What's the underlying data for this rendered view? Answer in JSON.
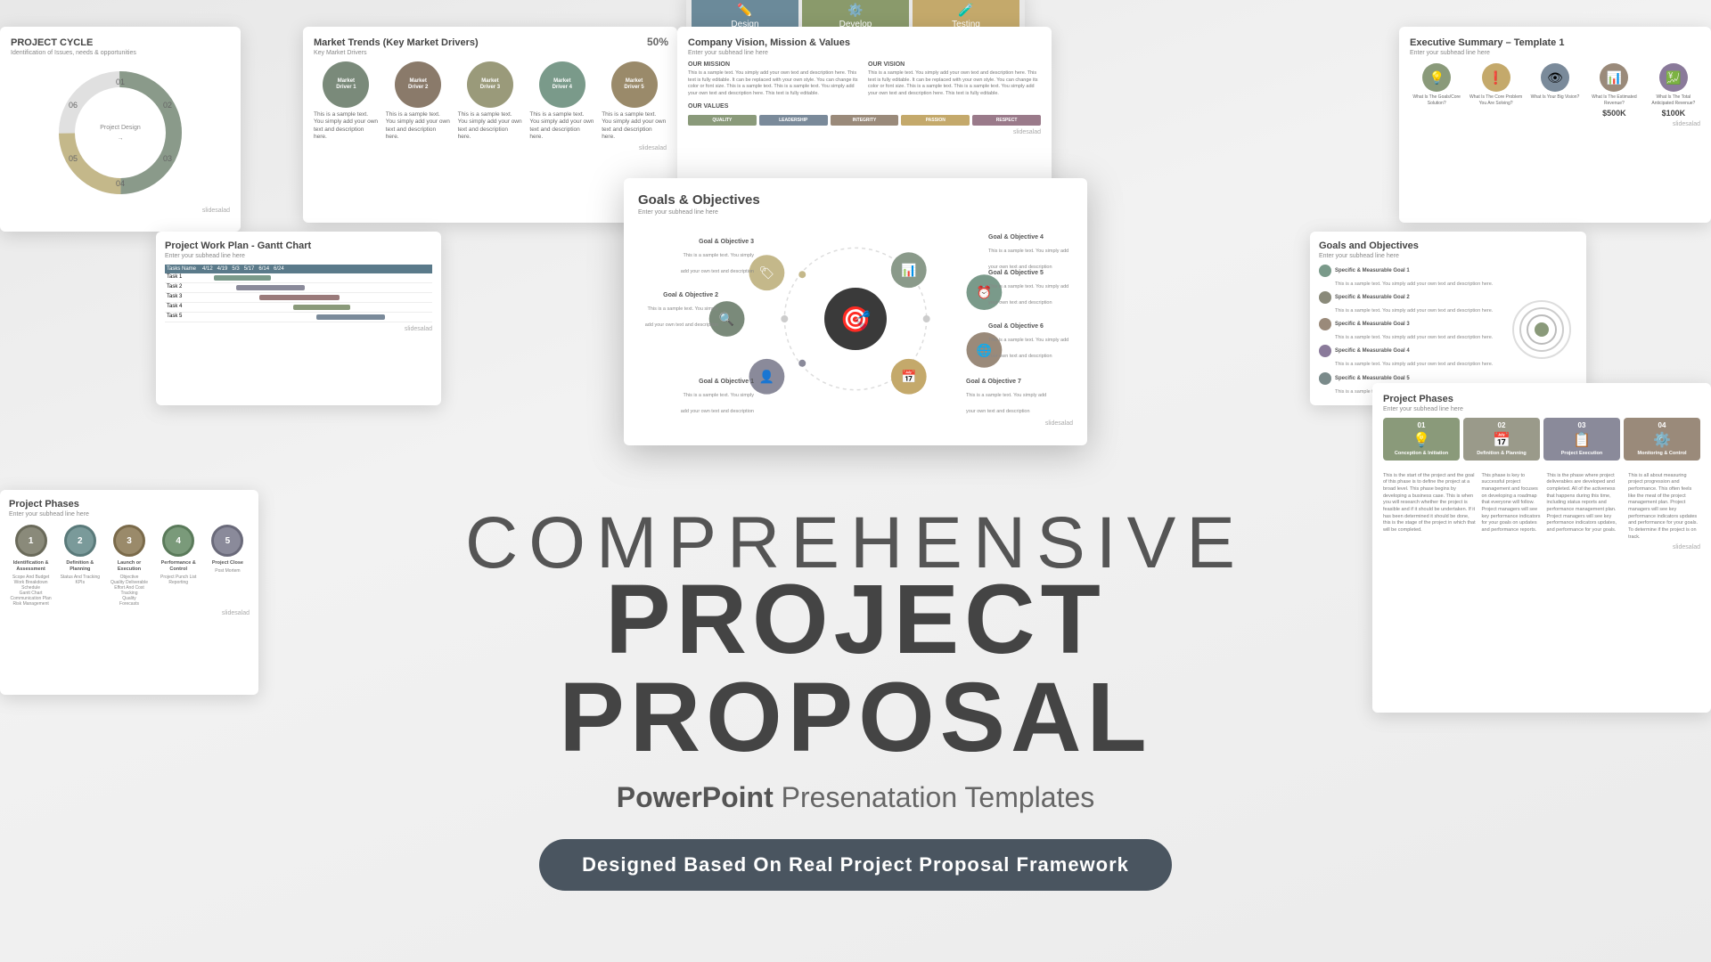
{
  "page": {
    "title": "Comprehensive Project Proposal",
    "subtitle_line1": "COMPREHENSIVE",
    "subtitle_line2": "PROJECT PROPOSAL",
    "subtitle_desc": "PowerPoint Presenatation Templates",
    "subtitle_desc_bold": "PowerPoint",
    "badge_text": "Designed Based On Real Project Proposal Framework",
    "bg_color": "#f0f0f0"
  },
  "tabs_slide": {
    "tabs": [
      {
        "label": "Design",
        "icon": "✏️",
        "active": true,
        "color": "#6b8a9a"
      },
      {
        "label": "Develop",
        "icon": "⚙️",
        "active": true,
        "color": "#8a9a6b"
      },
      {
        "label": "Testing",
        "icon": "🧪",
        "active": true,
        "color": "#c4a96b"
      }
    ]
  },
  "project_cycle_slide": {
    "title": "PROJECT CYCLE",
    "subtitle": "Identification of Issues, needs & opportunities",
    "labels": [
      "01",
      "02",
      "03",
      "04",
      "05",
      "06"
    ],
    "brand": "slidesalad"
  },
  "market_trends_slide": {
    "title": "Market Trends (Key Market Drivers)",
    "subtitle": "Key Market Drivers",
    "percentage": "50%",
    "drivers": [
      {
        "label": "Market Driver 1",
        "color": "#7a8a7a"
      },
      {
        "label": "Market Driver 2",
        "color": "#8a7a6a"
      },
      {
        "label": "Market Driver 3",
        "color": "#9a9a7a"
      },
      {
        "label": "Market Driver 4",
        "color": "#7a9a8a"
      },
      {
        "label": "Market Driver 5",
        "color": "#9a8a6a"
      }
    ],
    "driver_desc": "This is a sample text. You simply add your own text and description here.",
    "brand": "slidesalad"
  },
  "company_vision_slide": {
    "title": "Company Vision, Mission & Values",
    "subtitle": "Enter your subhead line here",
    "mission_title": "OUR MISSION",
    "mission_text": "This is a sample text. You simply add your own text and description here. This text is fully editable. It can be replaced with your own style. You can change its color or font size. This is a sample text. This is a sample text. You simply add your own text and description here. This text is fully editable.",
    "vision_title": "OUR VISION",
    "vision_text": "This is a sample text. You simply add your own text and description here. This text is fully editable. It can be replaced with your own style. You can change its color or font size. This is a sample text. This is a sample text. You simply add your own text and description here. This text is fully editable.",
    "values_title": "OUR VALUES",
    "values": [
      "QUALITY",
      "LEADERSHIP",
      "INTEGRITY",
      "PASSION",
      "RESPECT"
    ],
    "brand": "slidesalad"
  },
  "exec_summary_slide": {
    "title": "Executive Summary – Template 1",
    "subtitle": "Enter your subhead line here",
    "icons": [
      {
        "label": "What Is The Goals/Core Solution?",
        "icon": "💡",
        "color": "#8a9a7a"
      },
      {
        "label": "What Is The Core Problem You Are Solving?",
        "icon": "❗",
        "color": "#c4a96b"
      },
      {
        "label": "What Is Your Big Vision?",
        "icon": "👁",
        "color": "#7a8a9a"
      },
      {
        "label": "What Is The Estimated Revenue?",
        "icon": "📊",
        "color": "#9a8a7a"
      },
      {
        "label": "What Is The Total Anticipated Revenue?",
        "icon": "💹",
        "color": "#8a7a9a"
      }
    ],
    "revenue1": "$500K",
    "revenue2": "$100K",
    "brand": "slidesalad"
  },
  "goals_slide": {
    "title": "Goals & Objectives",
    "subtitle": "Enter your subhead line here",
    "center_icon": "🎯",
    "goals": [
      {
        "label": "Goal & Objective 1",
        "desc": "This is a sample text. You simply add your own text and description",
        "icon": "👤",
        "position": "bottom-left"
      },
      {
        "label": "Goal & Objective 2",
        "desc": "This is a sample text. You simply add your own text and description",
        "icon": "🔍",
        "position": "left"
      },
      {
        "label": "Goal & Objective 3",
        "desc": "This is a sample text. You simply add your own text and description",
        "icon": "🏷️",
        "position": "top-left"
      },
      {
        "label": "Goal & Objective 4",
        "desc": "This is a sample text. You simply add your own text and description",
        "icon": "📊",
        "position": "top-right"
      },
      {
        "label": "Goal & Objective 5",
        "desc": "This is a sample text. You simply add your own text and description",
        "icon": "⏰",
        "position": "right"
      },
      {
        "label": "Goal & Objective 6",
        "desc": "This is a sample text. You simply add your own text and description",
        "icon": "🌐",
        "position": "right-lower"
      },
      {
        "label": "Goal & Objective 7",
        "desc": "This is a sample text. You simply add your own text and description",
        "icon": "📅",
        "position": "bottom-right"
      }
    ],
    "brand": "slidesalad"
  },
  "work_plan_slide": {
    "title": "Project Work Plan - Gantt Chart",
    "subtitle": "Enter your subhead line here",
    "tasks": [
      {
        "name": "Task 1",
        "start": "5%",
        "width": "25%",
        "color": "#7a9a8a"
      },
      {
        "name": "Task 2",
        "start": "15%",
        "width": "30%",
        "color": "#8a8a9a"
      },
      {
        "name": "Task 3",
        "start": "25%",
        "width": "35%",
        "color": "#9a7a7a"
      },
      {
        "name": "Task 4",
        "start": "40%",
        "width": "25%",
        "color": "#8a9a7a"
      },
      {
        "name": "Task 5",
        "start": "50%",
        "width": "30%",
        "color": "#7a8a9a"
      }
    ],
    "brand": "slidesalad"
  },
  "goals2_slide": {
    "title": "Goals and Objectives",
    "subtitle": "Enter your subhead line here",
    "items": [
      {
        "label": "Specific & Measurable Goal 1",
        "desc": "This is a sample text. You simply add your own text and description here.",
        "color": "#7a9a8a"
      },
      {
        "label": "Specific & Measurable Goal 2",
        "desc": "This is a sample text. You simply add your own text and description here.",
        "color": "#8a8a7a"
      },
      {
        "label": "Specific & Measurable Goal 3",
        "desc": "This is a sample text. You simply add your own text and description here.",
        "color": "#9a8a7a"
      },
      {
        "label": "Specific & Measurable Goal 4",
        "desc": "This is a sample text. You simply add your own text and description here.",
        "color": "#8a7a9a"
      },
      {
        "label": "Specific & Measurable Goal 5",
        "desc": "This is a sample text. You simply add your own text and description here.",
        "color": "#7a8a8a"
      }
    ],
    "brand": "slidesalad"
  },
  "phases_left_slide": {
    "title": "Project Phases",
    "subtitle": "Enter your subhead line here",
    "phases": [
      {
        "num": "1",
        "label": "Identification & Assessment",
        "color": "#9a9a8a",
        "border": "#7a7a6a"
      },
      {
        "num": "2",
        "label": "Definition & Planning",
        "color": "#8a9a9a",
        "border": "#6a7a7a"
      },
      {
        "num": "3",
        "label": "Launch or Execution",
        "color": "#9a8a7a",
        "border": "#7a6a5a"
      },
      {
        "num": "4",
        "label": "Performance & Control",
        "color": "#8a9a8a",
        "border": "#6a7a6a"
      },
      {
        "num": "5",
        "label": "Project Close",
        "color": "#8a8a9a",
        "border": "#6a6a7a"
      }
    ],
    "brand": "slidesalad"
  },
  "phases_right_slide": {
    "title": "Project Phases",
    "subtitle": "Enter your subhead line here",
    "phases": [
      {
        "num": "01",
        "label": "Conception & Initiation",
        "icon": "💡",
        "color": "#8a9a7a"
      },
      {
        "num": "02",
        "label": "Definition & Planning",
        "icon": "📅",
        "color": "#9a9a8a"
      },
      {
        "num": "03",
        "label": "Project Execution",
        "icon": "📋",
        "color": "#8a8a9a"
      },
      {
        "num": "04",
        "label": "Monitoring & Control",
        "icon": "⚙️",
        "color": "#9a8a7a"
      }
    ],
    "desc1": "This is the start of the project and the goal of this phase is to define the project at a broad level. This phase begins by developing a business case. This is when you will research whether the project is feasible and if it should be undertaken. If it has been determined it should be done, this is the stage of the project in which that will be completed.",
    "desc2": "This phase is key to successful project management and focuses on developing a roadmap that everyone will follow. Project managers will see key performance indicators for your goals on updates and performance reports.",
    "desc3": "This is the phase where project deliverables are developed and completed. All of the activeness that happens during this time, including status reports and performance management plan. Project managers will see key performance indicators updates, and performance for your goals.",
    "desc4": "This is all about measuring project progression and performance. This often feels like the meat of the project management plan. Project managers will see key performance indicators updates and performance for your goals. To determine if the project is on track.",
    "brand": "slidesalad"
  }
}
